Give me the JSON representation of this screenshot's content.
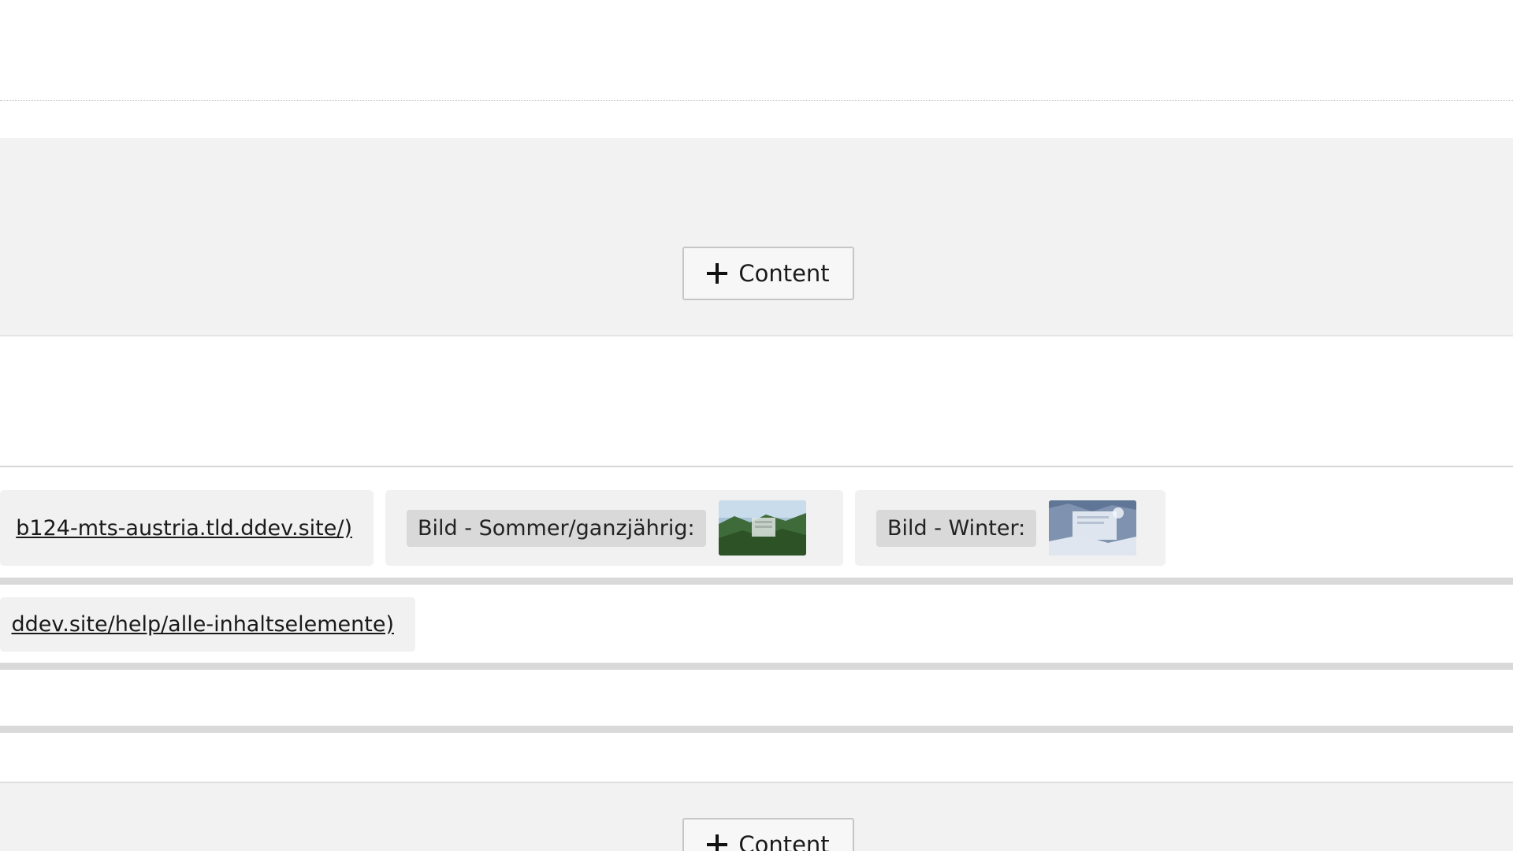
{
  "content_area": {
    "top_dropzone": {
      "add_button_label": "Content",
      "icon": "plus-icon"
    },
    "bottom_dropzone": {
      "add_button_label": "Content",
      "icon": "plus-icon"
    }
  },
  "record": {
    "row1": {
      "link": "b124-mts-austria.tld.ddev.site/)",
      "image_summer": {
        "label": "Bild - Sommer/ganzjährig:",
        "thumbnail": "summer-landscape-thumbnail"
      },
      "image_winter": {
        "label": "Bild - Winter:",
        "thumbnail": "winter-landscape-thumbnail"
      }
    },
    "row2": {
      "link": "ddev.site/help/alle-inhaltselemente)"
    }
  },
  "colors": {
    "dropzone_bg": "#f2f2f2",
    "chip_bg": "#f1f1f1",
    "label_bg": "#d9d9d9",
    "separator": "#d9d9d9"
  }
}
